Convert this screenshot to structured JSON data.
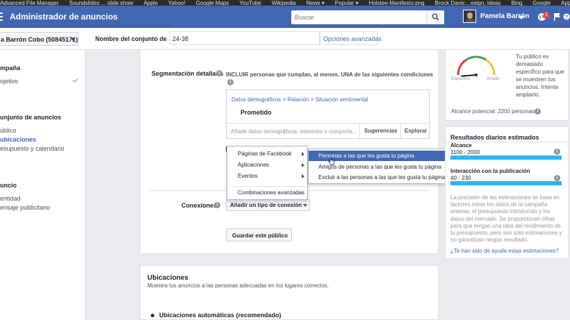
{
  "bookmarks": [
    "Advanced File Manager",
    "Soundslides ... slide show",
    "Apple",
    "Yahoo!",
    "Google Maps",
    "YouTube",
    "Wikipedia",
    "News ▾",
    "Popular ▾",
    "Holstee-Manifesto.png",
    "Brock Davis:...esign, Ideas",
    "Bing",
    "Google",
    "Apple"
  ],
  "header": {
    "title": "Administrador de anuncios",
    "search_placeholder": "Buscar",
    "user_name": "Pamela Barrón",
    "notification_count": "1",
    "brand_color": "#4267b2"
  },
  "account": {
    "name": "a Barrón Cobo (50845171)",
    "adset_label": "Nombre del conjunto de anuncios",
    "adset_value": "24-38",
    "advanced_options": "Opciones avanzadas"
  },
  "sidebar": {
    "sections": [
      {
        "heading": "mpaña",
        "items": [
          {
            "label": "ojetivo",
            "active": false,
            "checked": true
          }
        ]
      },
      {
        "heading": "unjunto de anuncios",
        "items": [
          {
            "label": "úblico",
            "active": false
          },
          {
            "label": "ubicaciones",
            "active": true
          },
          {
            "label": "esupuesto y calendario",
            "active": false
          }
        ]
      },
      {
        "heading": "uncio",
        "items": [
          {
            "label": "entidad",
            "active": false
          },
          {
            "label": "ensaje publicitario",
            "active": false
          }
        ]
      }
    ]
  },
  "targeting": {
    "label": "Segmentación detallada",
    "include_text": "INCLUIR personas que cumplan, al menos, UNA de las siguientes condiciones",
    "breadcrumb": [
      "Datos demográficos",
      "Relación",
      "Situación sentimental"
    ],
    "breadcrumb_sep": ">",
    "selected_value": "Prometido",
    "input_placeholder": "Añade datos demográficos, intereses o comporta...",
    "suggestions_label": "Sugerencias",
    "explore_label": "Explorar"
  },
  "connections": {
    "label": "Conexiones",
    "button_label": "Añadir un tipo de conexión"
  },
  "save_audience_label": "Guardar este público",
  "menu_primary": {
    "items": [
      {
        "label": "Páginas de Facebook",
        "has_submenu": true
      },
      {
        "label": "Aplicaciones",
        "has_submenu": true
      },
      {
        "label": "Eventos",
        "has_submenu": true
      },
      {
        "label": "Combinaciones avanzadas",
        "has_submenu": false
      }
    ]
  },
  "menu_secondary": {
    "items": [
      {
        "label": "Personas a las que les gusta tu página",
        "highlighted": true
      },
      {
        "label": "Amigos de personas a las que les gusta tu página",
        "highlighted": false
      },
      {
        "label": "Excluir a las personas a las que les gusta tu página",
        "highlighted": false
      }
    ]
  },
  "placements": {
    "title": "Ubicaciones",
    "description": "Muestra tus anuncios a las personas adecuadas en los lugares correctos.",
    "auto_option": "Ubicaciones automáticas (recomendado)"
  },
  "audience": {
    "gauge_specific": "Específico",
    "gauge_broad": "Amplio",
    "gauge_level": 0.05,
    "message": "Tu público es demasiado específico para que se muestren tus anuncios. Intenta ampliarlo.",
    "potential_reach": "Alcance potencial: 2200 personas"
  },
  "results": {
    "title": "Resultados diarios estimados",
    "reach_label": "Alcance",
    "reach_value": "1100 - 2000",
    "engagement_label": "Interacción con la publicación",
    "engagement_value": "40 - 230",
    "bar_color": "#29b6f6",
    "note": "La precisión de las estimaciones se basa en factores como los datos de la campaña anterior, el presupuesto introducido y los datos del mercado. Se proporcionan cifras para que tengas una idea del rendimiento de tu presupuesto, pero son solo estimaciones y no garantizan ningún resultado.",
    "help_link": "¿Te han sido de ayuda estas estimaciones?"
  }
}
